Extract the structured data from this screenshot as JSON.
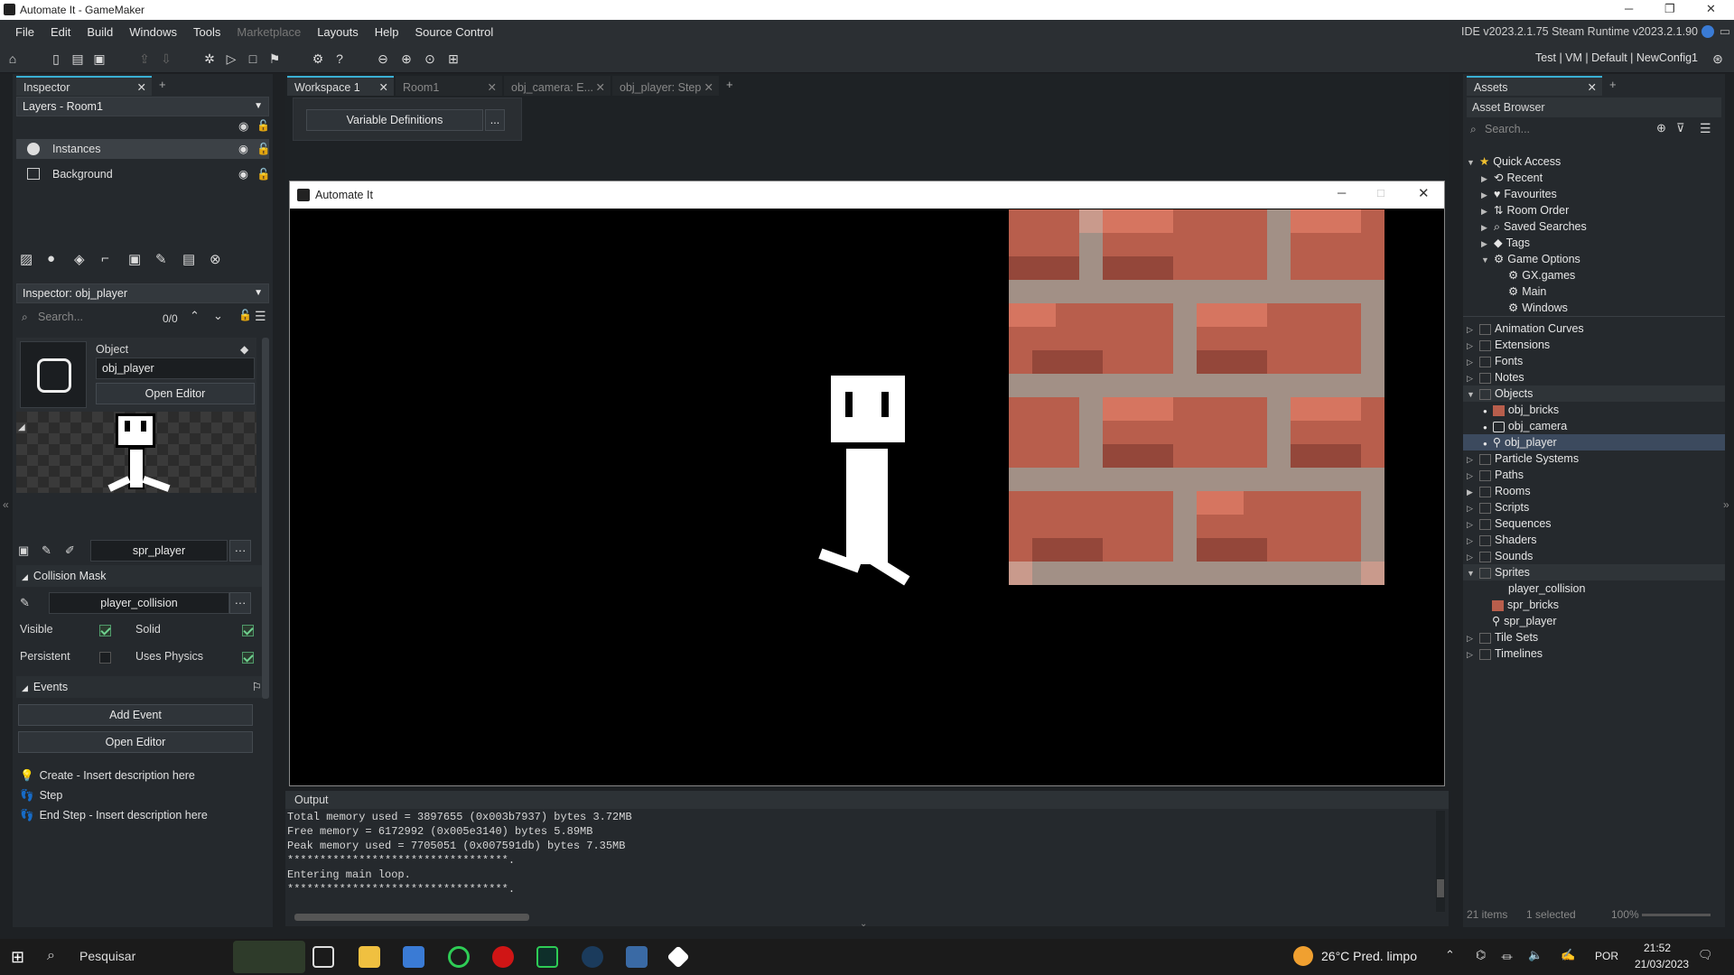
{
  "window": {
    "title": "Automate It - GameMaker"
  },
  "menu": {
    "items": [
      "File",
      "Edit",
      "Build",
      "Windows",
      "Tools",
      "Marketplace",
      "Layouts",
      "Help",
      "Source Control"
    ],
    "ide_info": "IDE v2023.2.1.75 Steam  Runtime v2023.2.1.90"
  },
  "toolbar": {
    "config": "Test  |  VM  |  Default  |  NewConfig1"
  },
  "inspector": {
    "tab_label": "Inspector",
    "layers_select": "Layers - Room1",
    "layers": [
      {
        "name": "Instances"
      },
      {
        "name": "Background"
      }
    ],
    "inspector_select": "Inspector: obj_player",
    "search_placeholder": "Search...",
    "search_count": "0/0",
    "object_label": "Object",
    "object_name": "obj_player",
    "open_editor": "Open Editor",
    "sprite_name": "spr_player",
    "collision_mask_label": "Collision Mask",
    "collision_mask_value": "player_collision",
    "visible_label": "Visible",
    "solid_label": "Solid",
    "persistent_label": "Persistent",
    "uses_physics_label": "Uses Physics",
    "visible": true,
    "solid": true,
    "persistent": false,
    "uses_physics": true,
    "events_label": "Events",
    "add_event": "Add Event",
    "open_editor_2": "Open Editor",
    "events": [
      {
        "label": "Create - Insert description here"
      },
      {
        "label": "Step"
      },
      {
        "label": "End Step - Insert description here"
      }
    ]
  },
  "workspace": {
    "tabs": [
      "Workspace 1",
      "Room1",
      "obj_camera: E...",
      "obj_player: Step"
    ],
    "variable_definitions": "Variable Definitions",
    "dots": "..."
  },
  "game_window": {
    "title": "Automate It"
  },
  "output": {
    "label": "Output",
    "lines": [
      "Total memory used = 3897655 (0x003b7937) bytes 3.72MB",
      "Free memory = 6172992 (0x005e3140) bytes 5.89MB",
      "Peak memory used = 7705051 (0x007591db) bytes 7.35MB",
      "**********************************.",
      "Entering main loop.",
      "**********************************."
    ]
  },
  "assets": {
    "tab_label": "Assets",
    "browser_label": "Asset Browser",
    "search_placeholder": "Search...",
    "quick_access": "Quick Access",
    "quick_items": [
      "Recent",
      "Favourites",
      "Room Order",
      "Saved Searches",
      "Tags",
      "Game Options"
    ],
    "game_options_items": [
      "GX.games",
      "Main",
      "Windows"
    ],
    "groups": [
      "Animation Curves",
      "Extensions",
      "Fonts",
      "Notes",
      "Objects"
    ],
    "objects": [
      "obj_bricks",
      "obj_camera",
      "obj_player"
    ],
    "groups2": [
      "Particle Systems",
      "Paths",
      "Rooms",
      "Scripts",
      "Sequences",
      "Shaders",
      "Sounds",
      "Sprites"
    ],
    "sprites": [
      "player_collision",
      "spr_bricks",
      "spr_player"
    ],
    "groups3": [
      "Tile Sets",
      "Timelines"
    ],
    "status_items": "21 items",
    "status_selected": "1 selected",
    "zoom": "100%"
  },
  "taskbar": {
    "search": "Pesquisar",
    "weather": "26°C  Pred. limpo",
    "lang": "POR",
    "time": "21:52",
    "date": "21/03/2023"
  },
  "colors": {
    "accent": "#3ab0d4",
    "selected_row": "#3c4a5e",
    "brick": "#c4725f"
  }
}
